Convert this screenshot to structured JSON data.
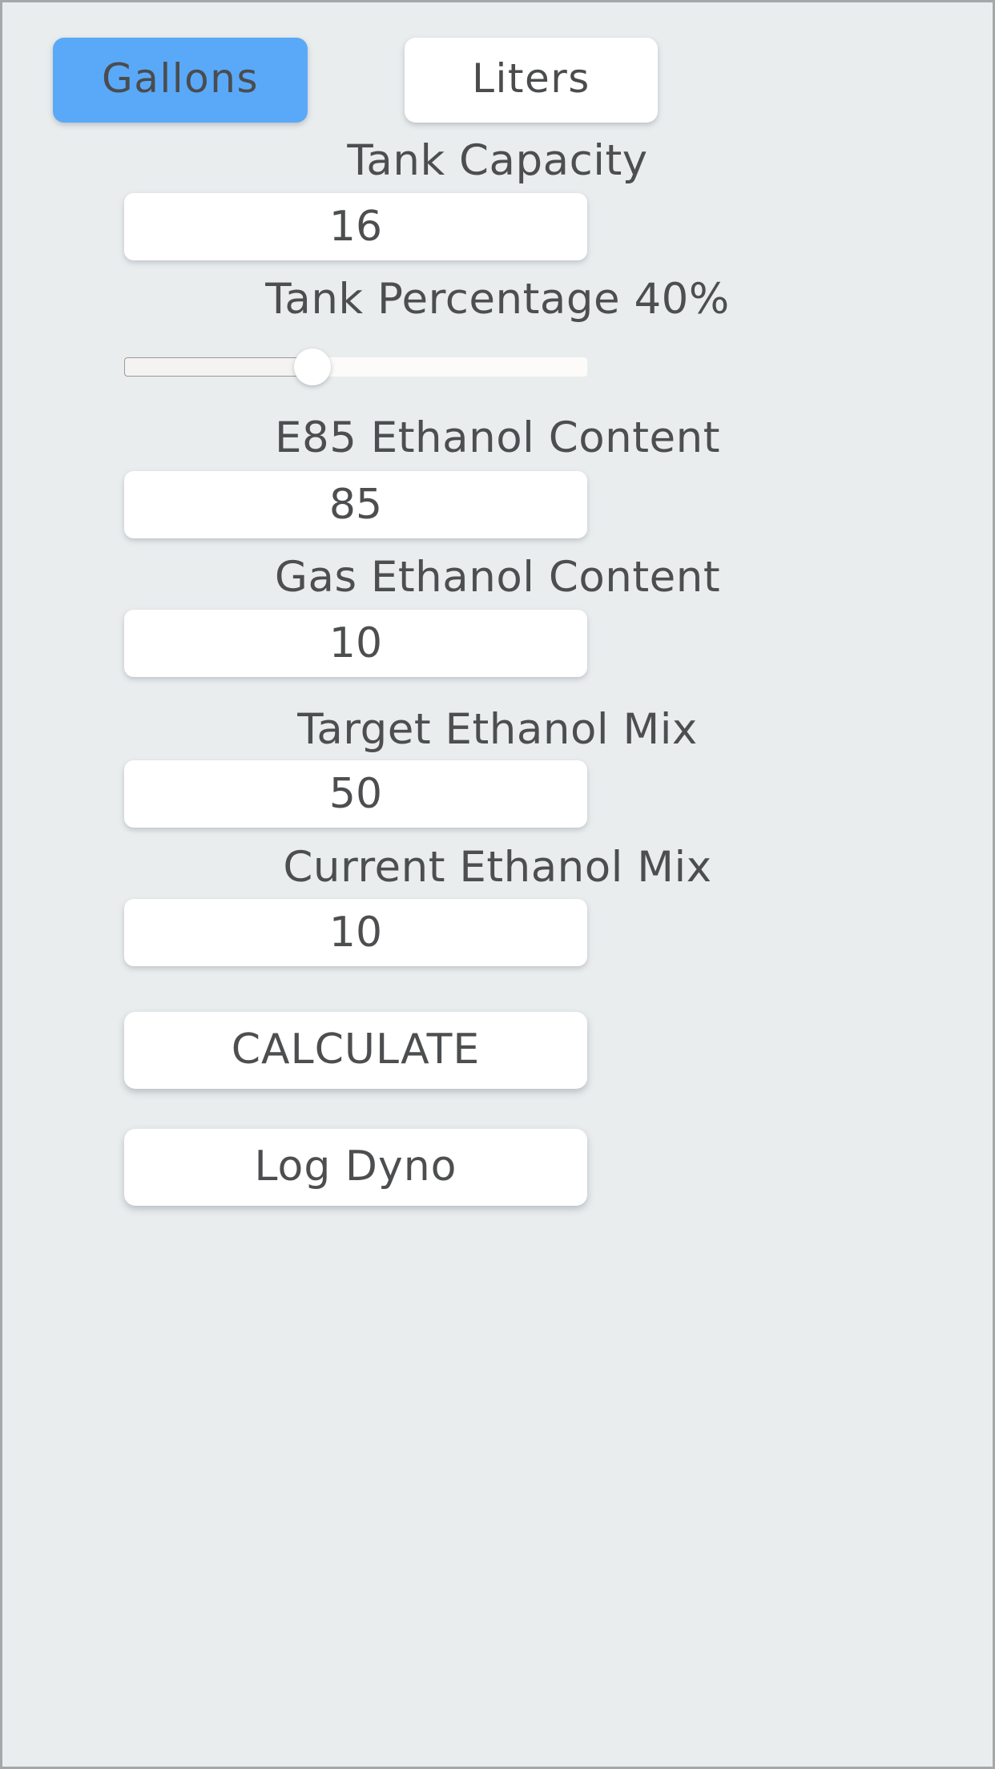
{
  "app": {
    "background_color": "#e9edee",
    "border_color": "#a4a8aa",
    "text_color": "#4c4e50",
    "accent_color": "#5aa9f8",
    "surface_color": "#ffffff"
  },
  "unit_toggle": {
    "selected": "Gallons",
    "gallons_label": "Gallons",
    "liters_label": "Liters"
  },
  "fields": {
    "tank_capacity": {
      "label": "Tank Capacity",
      "value": "16"
    },
    "tank_percentage": {
      "label": "Tank Percentage 40%",
      "percent": 40,
      "min": 0,
      "max": 100
    },
    "e85_ethanol_content": {
      "label": "E85 Ethanol Content",
      "value": "85"
    },
    "gas_ethanol_content": {
      "label": "Gas Ethanol Content",
      "value": "10"
    },
    "target_ethanol_mix": {
      "label": "Target Ethanol Mix",
      "value": "50"
    },
    "current_ethanol_mix": {
      "label": "Current Ethanol Mix",
      "value": "10"
    }
  },
  "actions": {
    "calculate_label": "CALCULATE",
    "log_dyno_label": "Log Dyno"
  }
}
